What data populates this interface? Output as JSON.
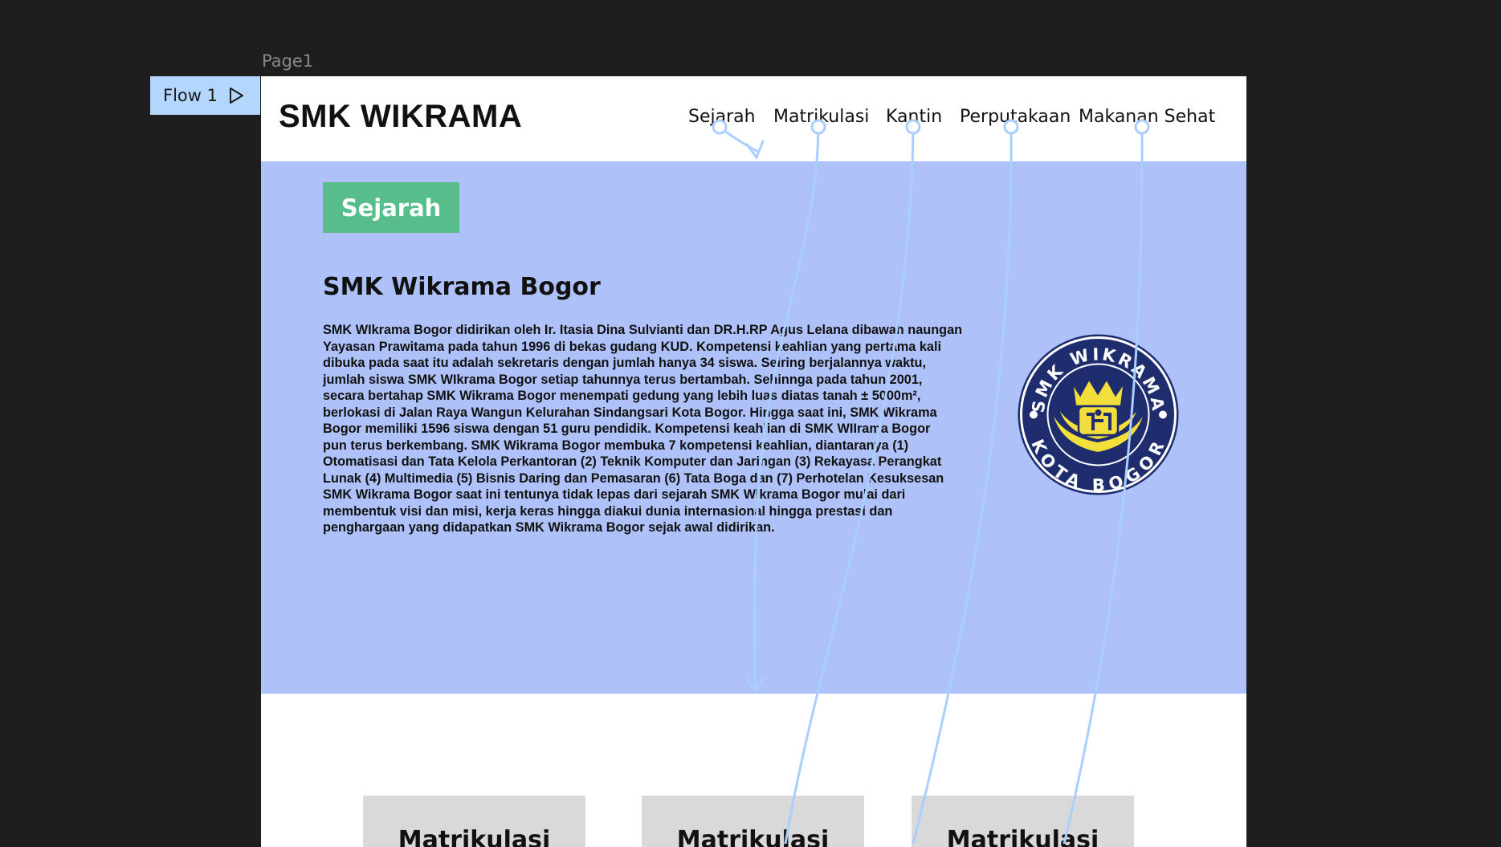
{
  "canvas": {
    "frame_label": "Page1",
    "flow_label": "Flow 1"
  },
  "navbar": {
    "brand": "SMK WIKRAMA",
    "links": [
      "Sejarah",
      "Matrikulasi",
      "Kantin",
      "Perputakaan",
      "Makanan Sehat"
    ]
  },
  "hero": {
    "section_badge": "Sejarah",
    "title": "SMK Wikrama Bogor",
    "lines": [
      "SMK WIkrama Bogor didirikan oleh Ir. Itasia Dina Sulvianti dan DR.H.RP Agus Lelana dibawah naungan",
      "Yayasan Prawitama pada tahun 1996 di bekas gudang KUD. Kompetensi keahlian yang pertama kali",
      "dibuka pada saat itu adalah sekretaris dengan jumlah hanya 34 siswa. Seiring berjalannya waktu,",
      "jumlah siswa SMK WIkrama Bogor setiap tahunnya terus bertambah. Sehinnga pada tahun 2001,",
      "secara bertahap SMK Wikrama Bogor menempati gedung yang lebih luas diatas tanah ± 5000m²,",
      "berlokasi di Jalan Raya Wangun Kelurahan Sindangsari Kota Bogor. Hingga saat ini, SMK Wikrama",
      "Bogor memiliki 1596 siswa dengan 51 guru pendidik. Kompetensi keahlian di SMK WIIrama Bogor",
      "pun terus berkembang. SMK Wikrama Bogor membuka 7 kompetensi keahlian, diantaranya (1)",
      "Otomatisasi dan Tata Kelola Perkantoran (2) Teknik Komputer dan Jaringan (3) Rekayasa Perangkat",
      "Lunak (4) Multimedia (5) Bisnis Daring dan Pemasaran (6) Tata Boga dan (7) Perhotelan Kesuksesan",
      "SMK Wikrama Bogor saat ini tentunya tidak lepas dari sejarah SMK Wikrama Bogor mulai dari",
      "membentuk visi dan misi, kerja keras hingga diakui dunia internasional hingga prestasi dan",
      "penghargaan yang didapatkan SMK Wikrama Bogor sejak awal didirikan."
    ],
    "logo_top_text": "SMK WIKRAMA",
    "logo_bottom_text": "KOTA BOGOR"
  },
  "cards": [
    "Matrikulasi",
    "Matrikulasi",
    "Matrikulasi"
  ],
  "colors": {
    "canvas_bg": "#1e1e1e",
    "hero_bg": "#aec2f9",
    "badge_bg": "#56bd8b",
    "flow_tag_bg": "#b3d6ff",
    "prototype_link": "#a9cfff",
    "card_bg": "#d9d9d9",
    "logo_navy": "#1f2d6e",
    "logo_yellow": "#f2df3c"
  }
}
